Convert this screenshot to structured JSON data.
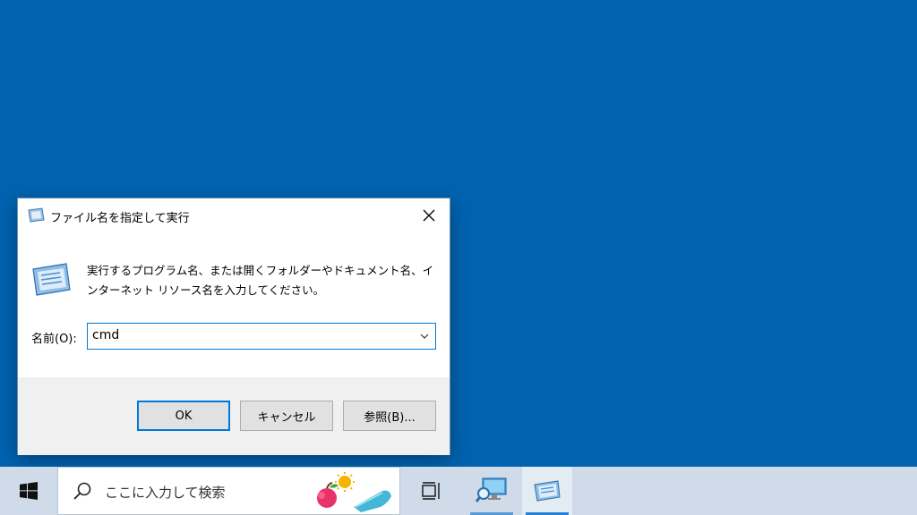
{
  "dialog": {
    "title": "ファイル名を指定して実行",
    "description_line1": "実行するプログラム名、または開くフォルダーやドキュメント名、イ",
    "description_line2": "ンターネット リソース名を入力してください。",
    "name_label": "名前(O):",
    "name_value": "cmd",
    "ok_label": "OK",
    "cancel_label": "キャンセル",
    "browse_label": "参照(B)..."
  },
  "taskbar": {
    "search_placeholder": "ここに入力して検索",
    "apps": [
      {
        "icon": "remote-desktop-icon"
      },
      {
        "icon": "run-icon",
        "active": true
      }
    ]
  },
  "colors": {
    "desktop": "#0063b1",
    "accent": "#0078d7",
    "taskbar": "#cfdbe8"
  }
}
